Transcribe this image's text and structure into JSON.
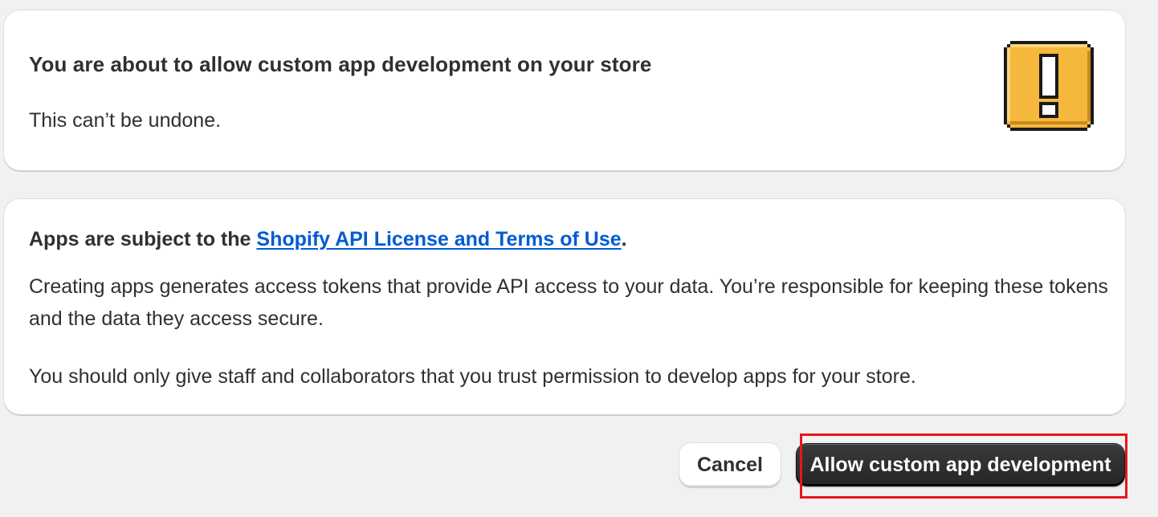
{
  "warning_card": {
    "title": "You are about to allow custom app development on your store",
    "subtitle": "This can’t be undone.",
    "icon": "exclamation-warning-icon"
  },
  "info_card": {
    "lead_prefix": "Apps are subject to the ",
    "lead_link": "Shopify API License and Terms of Use",
    "lead_suffix": ".",
    "paragraph_1": "Creating apps generates access tokens that provide API access to your data. You’re responsible for keeping these tokens and the data they access secure.",
    "paragraph_2": "You should only give staff and collaborators that you trust permission to develop apps for your store."
  },
  "actions": {
    "cancel_label": "Cancel",
    "confirm_label": "Allow custom app development"
  },
  "colors": {
    "background": "#f1f1f1",
    "link": "#005bd3",
    "primary_button": "#303030",
    "warning_icon": "#f5b83d",
    "highlight": "#e8151b"
  }
}
